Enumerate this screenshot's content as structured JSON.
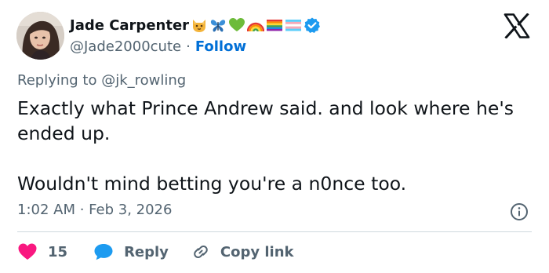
{
  "user": {
    "display_name": "Jade Carpenter",
    "handle": "@Jade2000cute",
    "follow_label": "Follow",
    "separator": "·",
    "name_emojis": [
      "cat-face-icon",
      "butterfly-icon",
      "green-heart-icon",
      "rainbow-icon",
      "rainbow-flag-icon",
      "transgender-flag-icon",
      "verified-badge-icon"
    ]
  },
  "reply": {
    "prefix": "Replying to ",
    "mention": "@jk_rowling"
  },
  "tweet": {
    "text": "Exactly what Prince Andrew said. and look where he's ended up.\n\nWouldn't mind betting you're a n0nce too.",
    "timestamp": "1:02 AM · Feb 3, 2026"
  },
  "actions": {
    "like_count": "15",
    "reply_label": "Reply",
    "copy_link_label": "Copy link"
  },
  "colors": {
    "like": "#f91880",
    "reply_bubble": "#1d9bf0",
    "follow": "#006fd6",
    "verified": "#1d9bf0",
    "muted": "#536471",
    "text": "#0f1419"
  }
}
